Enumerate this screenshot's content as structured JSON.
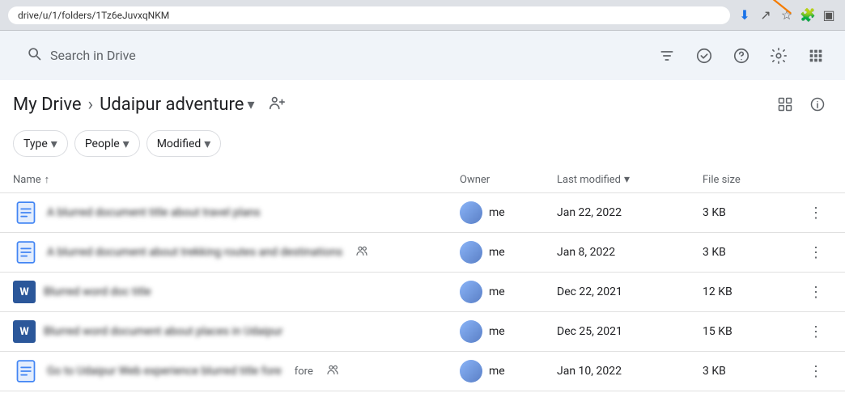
{
  "browser": {
    "url": "drive/u/1/folders/1Tz6eJuvxqNKM",
    "icons": [
      "download",
      "share",
      "star",
      "extension",
      "sidebar"
    ]
  },
  "search": {
    "placeholder": "Search in Drive",
    "filter_icon": "tune"
  },
  "topbar": {
    "check_icon": "✓",
    "help_icon": "?",
    "settings_icon": "⚙",
    "apps_icon": "⠿"
  },
  "breadcrumb": {
    "root": "My Drive",
    "current": "Udaipur adventure",
    "share_label": "Manage access"
  },
  "filters": [
    {
      "label": "Type",
      "id": "type-filter"
    },
    {
      "label": "People",
      "id": "people-filter"
    },
    {
      "label": "Modified",
      "id": "modified-filter"
    }
  ],
  "table": {
    "columns": {
      "name": "Name",
      "owner": "Owner",
      "last_modified": "Last modified",
      "file_size": "File size"
    },
    "files": [
      {
        "id": 1,
        "icon": "docs",
        "name": "A blurred document title about travel plans",
        "shared": false,
        "owner": "me",
        "date": "Jan 22, 2022",
        "size": "3 KB"
      },
      {
        "id": 2,
        "icon": "docs",
        "name": "A blurred document about trekking routes and destinations",
        "shared": true,
        "owner": "me",
        "date": "Jan 8, 2022",
        "size": "3 KB"
      },
      {
        "id": 3,
        "icon": "word",
        "name": "Blurred word doc title",
        "shared": false,
        "owner": "me",
        "date": "Dec 22, 2021",
        "size": "12 KB"
      },
      {
        "id": 4,
        "icon": "word",
        "name": "Blurred word document about places in Udaipur",
        "shared": false,
        "owner": "me",
        "date": "Dec 25, 2021",
        "size": "15 KB"
      },
      {
        "id": 5,
        "icon": "docs",
        "name": "Go to Udaipur Web experience blurred title fore",
        "shared": true,
        "owner": "me",
        "date": "Jan 10, 2022",
        "size": "3 KB"
      }
    ]
  }
}
